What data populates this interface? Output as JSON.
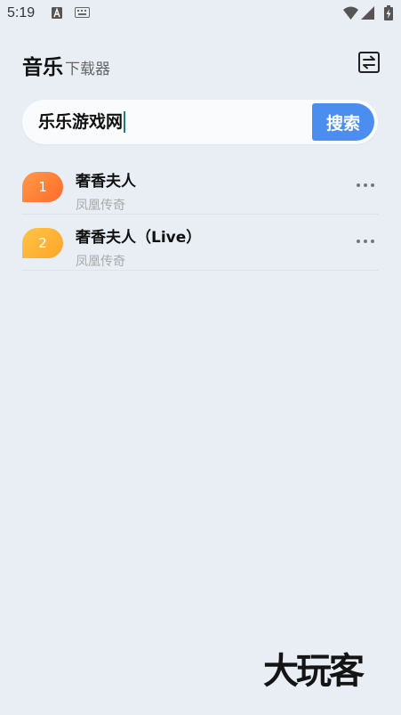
{
  "status_bar": {
    "time": "5:19"
  },
  "header": {
    "title_main": "音乐",
    "title_sub": "下载器"
  },
  "search": {
    "value": "乐乐游戏网",
    "button_label": "搜索"
  },
  "songs": [
    {
      "rank": "1",
      "title": "奢香夫人",
      "artist": "凤凰传奇",
      "badge_color": "#ff7a2e"
    },
    {
      "rank": "2",
      "title": "奢香夫人（Live）",
      "artist": "凤凰传奇",
      "badge_color": "#ffb52e"
    }
  ],
  "watermark": {
    "text": "大玩客"
  },
  "colors": {
    "background": "#e8eef4",
    "accent": "#4c8df0"
  }
}
